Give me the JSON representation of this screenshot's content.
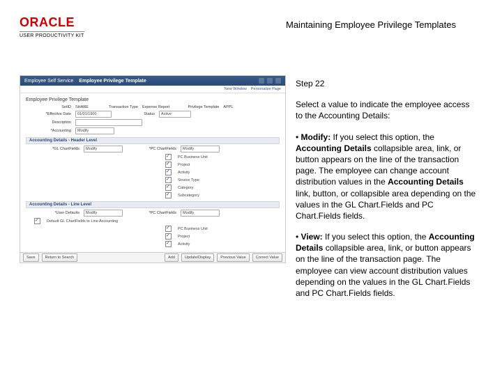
{
  "logo": {
    "brand": "ORACLE",
    "sub": "USER PRODUCTIVITY KIT"
  },
  "doc_title": "Maintaining Employee Privilege Templates",
  "step": "Step 22",
  "intro": "Select a value to indicate the employee access to the Accounting Details:",
  "opt1_lead": "Modify:",
  "opt1_a": " If you select this option, the ",
  "opt1_b": "Accounting Details",
  "opt1_c": " collapsible area, link, or button appears on the line of the transaction page. The employee can change account distribution values in the ",
  "opt1_d": "Accounting Details",
  "opt1_e": " link, button, or collapsible area depending on the values in the GL Chart.Fields and PC Chart.Fields fields.",
  "opt2_lead": "View:",
  "opt2_a": " If you select this option, the ",
  "opt2_b": "Accounting Details",
  "opt2_c": " collapsible area, link, or button appears on the line of the transaction page. The employee can view account distribution values depending on the values in the GL Chart.Fields and PC Chart.Fields fields.",
  "ss": {
    "crumb_left": "Employee Self Service",
    "banner_title": "Employee Privilege Template",
    "sublink1": "New Window",
    "sublink2": "Personalize Page",
    "page_h1": "Employee Privilege Template",
    "r1_lbl": "SetID",
    "r1_val": "SHARE",
    "r2_lbl": "Transaction Type",
    "r2_val": "Expense Report",
    "r3_lbl": "Privilege Template",
    "r3_val": "APPL",
    "eff_lbl": "*Effective Date",
    "eff_val": "01/01/1900",
    "status_lbl": "Status",
    "status_val": "Active",
    "desc_lbl": "Description",
    "desc_val": "",
    "acct_lbl": "*Accounting",
    "acct_val": "Modify",
    "sec1": "Accounting Details - Header Level",
    "gl_lbl": "*GL ChartFields",
    "gl_val": "Modify",
    "pc_lbl": "*PC ChartFields",
    "pc_val": "Modify",
    "chk1": "PC Business Unit",
    "chk2": "Project",
    "chk3": "Activity",
    "chk4": "Source Type",
    "chk5": "Category",
    "chk6": "Subcategory",
    "sec2": "Accounting Details - Line Level",
    "usr_lbl": "*User Defaults",
    "usr_val": "Modify",
    "def_chk": "Default GL ChartFields to Line Accounting",
    "btn_save": "Save",
    "btn_return": "Return to Search",
    "btn_add": "Add",
    "btn_update": "Update/Display",
    "btn_prev": "Previous Value",
    "btn_correct": "Correct Value"
  }
}
